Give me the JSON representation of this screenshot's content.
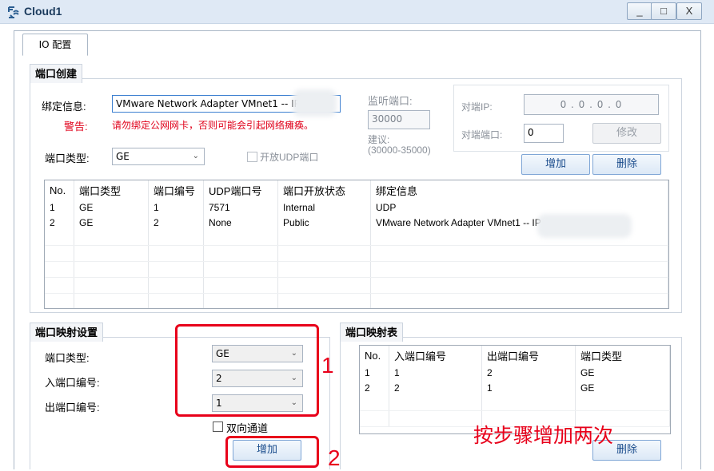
{
  "window": {
    "title": "Cloud1",
    "minimize_label": "_",
    "maximize_label": "□",
    "close_label": "X"
  },
  "tab": {
    "label": "IO 配置"
  },
  "port_create": {
    "title": "端口创建",
    "bind_label": "绑定信息:",
    "bind_value": "VMware Network Adapter VMnet1 -- IP: 1",
    "warning_label": "警告:",
    "warning_text": "请勿绑定公网网卡，否则可能会引起网络瘫痪。",
    "port_type_label": "端口类型:",
    "port_type_value": "GE",
    "udp_open_label": "开放UDP端口",
    "listen_port_label": "监听端口:",
    "listen_port_value": "30000",
    "suggest_label": "建议:",
    "suggest_range": "(30000-35000)",
    "peer_ip_label": "对端IP:",
    "peer_ip_value": "0  .  0  .  0  .  0",
    "peer_port_label": "对端端口:",
    "peer_port_value": "0",
    "modify_button": "修改",
    "add_button": "增加",
    "delete_button": "删除"
  },
  "port_table": {
    "headers": [
      "No.",
      "端口类型",
      "端口编号",
      "UDP端口号",
      "端口开放状态",
      "绑定信息"
    ],
    "rows": [
      [
        "1",
        "GE",
        "1",
        "7571",
        "Internal",
        "UDP"
      ],
      [
        "2",
        "GE",
        "2",
        "None",
        "Public",
        "VMware Network Adapter VMnet1 -- IP"
      ]
    ]
  },
  "mapping_setup": {
    "title": "端口映射设置",
    "port_type_label": "端口类型:",
    "port_type_value": "GE",
    "in_port_label": "入端口编号:",
    "in_port_value": "2",
    "out_port_label": "出端口编号:",
    "out_port_value": "1",
    "bidirectional_label": "双向通道",
    "add_button": "增加"
  },
  "mapping_table": {
    "title": "端口映射表",
    "headers": [
      "No.",
      "入端口编号",
      "出端口编号",
      "端口类型"
    ],
    "rows": [
      [
        "1",
        "1",
        "2",
        "GE"
      ],
      [
        "2",
        "2",
        "1",
        "GE"
      ]
    ],
    "delete_button": "删除"
  },
  "annotations": {
    "step1": "1",
    "step2": "2",
    "note": "按步骤增加两次"
  },
  "colors": {
    "annotation": "#e8001a",
    "warning": "#e0001a",
    "titlebar": "#dfe9f5"
  }
}
